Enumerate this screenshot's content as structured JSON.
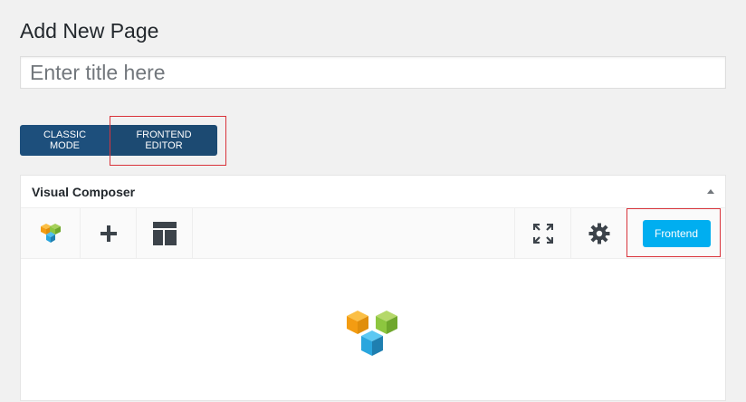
{
  "page": {
    "title": "Add New Page"
  },
  "title_field": {
    "placeholder": "Enter title here",
    "value": ""
  },
  "editor_modes": {
    "classic_label": "CLASSIC MODE",
    "frontend_label": "FRONTEND EDITOR"
  },
  "composer": {
    "title": "Visual Composer",
    "toolbar": {
      "icons": [
        "vc-logo-icon",
        "plus-icon",
        "layout-templates-icon",
        "fullscreen-icon",
        "gear-icon"
      ],
      "frontend_label": "Frontend"
    },
    "body_icon": "vc-logo-icon"
  },
  "colors": {
    "mode_button_bg": "#1d4f7c",
    "frontend_button_bg": "#00aef0",
    "highlight_border": "#d9343b",
    "logo_orange": "#f7a823",
    "logo_green": "#8dc63f",
    "logo_blue": "#2aa6de"
  }
}
